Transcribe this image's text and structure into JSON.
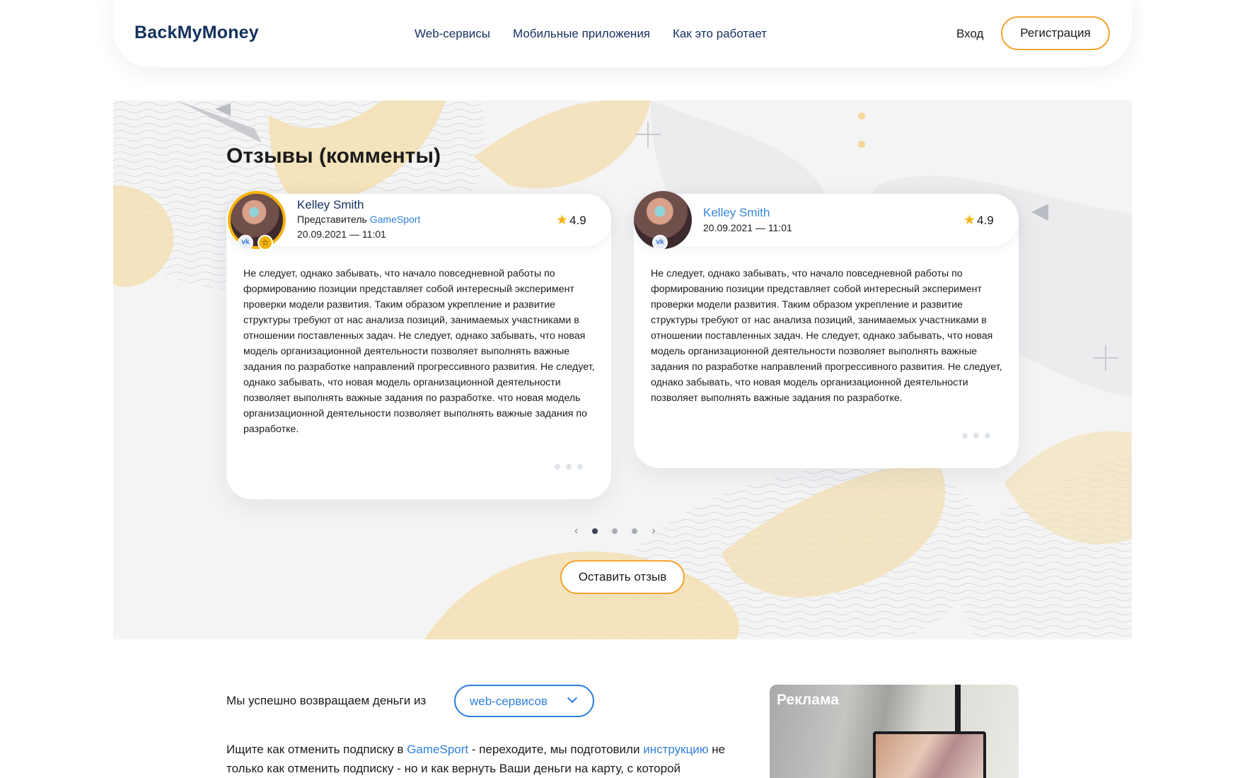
{
  "header": {
    "logo": "BackMyMoney",
    "nav": [
      "Web-сервисы",
      "Мобильные приложения",
      "Как это работает"
    ],
    "login": "Вход",
    "register": "Регистрация"
  },
  "reviews": {
    "title": "Отзывы (комменты)",
    "cards": [
      {
        "name": "Kelley Smith",
        "role_prefix": "Представитель",
        "role_link": "GameSport",
        "date": "20.09.2021 — 11:01",
        "rating": "4.9",
        "text": "Не следует, однако забывать, что начало повседневной работы по формированию позиции представляет собой интересный эксперимент проверки модели развития. Таким образом укрепление и развитие структуры требуют от нас анализа позиций, занимаемых участниками в отношении поставленных задач. Не следует, однако забывать, что новая модель организационной деятельности позволяет выполнять важные задания по разработке направлений прогрессивного развития. Не следует, однако забывать, что новая модель организационной деятельности позволяет выполнять важные задания по разработке. что новая модель организационной деятельности позволяет выполнять важные задания по разработке."
      },
      {
        "name": "Kelley Smith",
        "date": "20.09.2021 — 11:01",
        "rating": "4.9",
        "text": "Не следует, однако забывать, что начало повседневной работы по формированию позиции представляет собой интересный эксперимент проверки модели развития. Таким образом укрепление и развитие структуры требуют от нас анализа позиций, занимаемых участниками в отношении поставленных задач. Не следует, однако забывать, что новая модель организационной деятельности позволяет выполнять важные задания по разработке направлений прогрессивного развития. Не следует, однако забывать, что новая модель организационной деятельности позволяет выполнять важные задания по разработке."
      }
    ],
    "avatar_badge": "vk",
    "pager": {
      "prev": "‹",
      "next": "›",
      "pages": 3,
      "active": 1
    },
    "leave_button": "Оставить отзыв"
  },
  "returns": {
    "label": "Мы успешно возвращаем деньги из",
    "select_value": "web-сервисов",
    "text_1": "Ищите как отменить подписку в ",
    "link_1": "GameSport",
    "text_2": " - переходите, мы подготовили ",
    "link_2": "инструкцию",
    "text_3": " не только как отменить подписку - но и как вернуть Ваши деньги на карту, с которой"
  },
  "ad": {
    "label": "Реклама"
  },
  "colors": {
    "accent_orange": "#f2a531",
    "link_blue": "#2f7fd8",
    "navy": "#14305e",
    "star": "#f5b40c"
  }
}
